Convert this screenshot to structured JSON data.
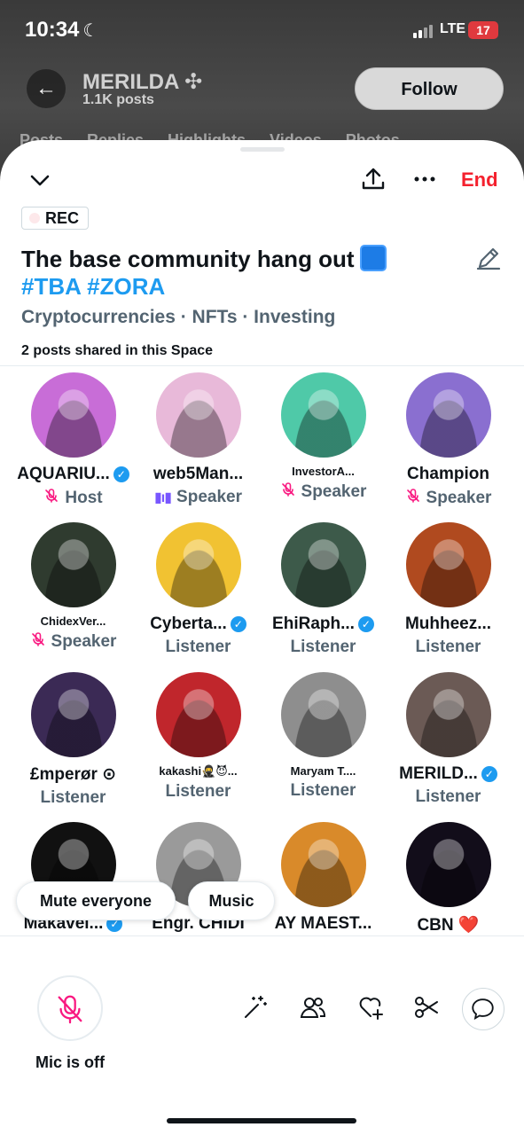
{
  "status_bar": {
    "time": "10:34",
    "network": "LTE",
    "battery": "17"
  },
  "profile": {
    "name": "MERILDA",
    "posts": "1.1K posts",
    "follow_label": "Follow",
    "tabs": "Posts Replies Highlights Videos Photos"
  },
  "space": {
    "end_label": "End",
    "rec_label": "REC",
    "title": "The base community hang out",
    "hashtags": "#TBA #ZORA",
    "topics": "Cryptocurrencies · NFTs · Investing",
    "shared_posts": "2 posts shared in this Space"
  },
  "participants": [
    {
      "name": "AQUARIU...",
      "role": "Host",
      "verified": true,
      "mic": "off",
      "color": "#c86dd7"
    },
    {
      "name": "web5Man...",
      "role": "Speaker",
      "verified": false,
      "mic": "talking",
      "color": "#e8b9d9"
    },
    {
      "name": "InvestorA...",
      "role": "Speaker",
      "verified": false,
      "mic": "off",
      "color": "#4fc9a8"
    },
    {
      "name": "Champion",
      "role": "Speaker",
      "verified": false,
      "mic": "off",
      "color": "#8a6fd0"
    },
    {
      "name": "ChidexVer...",
      "role": "Speaker",
      "verified": false,
      "mic": "off",
      "color": "#2f3b2f"
    },
    {
      "name": "Cyberta...",
      "role": "Listener",
      "verified": true,
      "mic": "",
      "color": "#f1c232"
    },
    {
      "name": "EhiRaph...",
      "role": "Listener",
      "verified": true,
      "mic": "",
      "color": "#3d5a4a"
    },
    {
      "name": "Muhheez...",
      "role": "Listener",
      "verified": false,
      "mic": "",
      "color": "#b04a1f"
    },
    {
      "name": "£mperør ⊙",
      "role": "Listener",
      "verified": false,
      "mic": "",
      "color": "#3b2a55"
    },
    {
      "name": "kakashi🥷😈...",
      "role": "Listener",
      "verified": false,
      "mic": "",
      "color": "#c0262c"
    },
    {
      "name": "Maryam T....",
      "role": "Listener",
      "verified": false,
      "mic": "",
      "color": "#8e8e8e"
    },
    {
      "name": "MERILD...",
      "role": "Listener",
      "verified": true,
      "mic": "",
      "color": "#6b5a55"
    },
    {
      "name": "Makavel...",
      "role": "",
      "verified": true,
      "mic": "",
      "color": "#111111"
    },
    {
      "name": "Engr. CHIDI",
      "role": "",
      "verified": false,
      "mic": "",
      "color": "#9a9a9a"
    },
    {
      "name": "AY MAEST...",
      "role": "",
      "verified": false,
      "mic": "",
      "color": "#d98a2a"
    },
    {
      "name": "CBN ❤️",
      "role": "",
      "verified": false,
      "mic": "",
      "color": "#120d1a"
    }
  ],
  "chips": {
    "mute_everyone": "Mute everyone",
    "music": "Music"
  },
  "bottom": {
    "mic_label": "Mic is off"
  },
  "colors": {
    "accent": "#1d9bf0",
    "end": "#f4212e",
    "mic_off": "#f91880"
  }
}
